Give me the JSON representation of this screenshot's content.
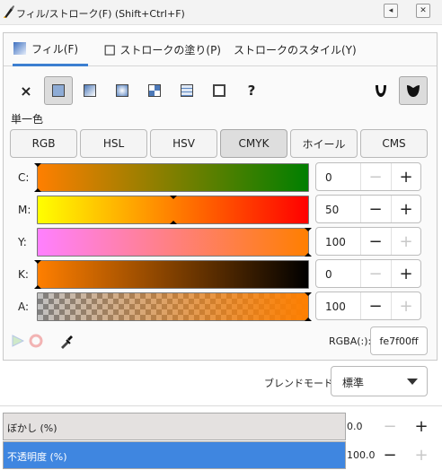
{
  "window": {
    "title": "フィル/ストローク(F) (Shift+Ctrl+F)",
    "detach_glyph": "◂",
    "close_glyph": "✕"
  },
  "tabs": [
    {
      "label": "フィル(F)",
      "icon": "fill-swatch-icon",
      "active": true
    },
    {
      "label": "ストロークの塗り(P)",
      "icon": "stroke-paint-icon",
      "active": false
    },
    {
      "label": "ストロークのスタイル(Y)",
      "icon": "stroke-style-icon",
      "active": false
    }
  ],
  "paint_types": {
    "none_glyph": "×",
    "unknown_glyph": "?",
    "items": [
      "no-paint-icon",
      "flat-color-icon",
      "linear-gradient-icon",
      "radial-gradient-icon",
      "pattern-icon",
      "swatch-grid-icon",
      "swatch-icon",
      "unset-paint-icon"
    ],
    "selected": "flat-color-icon",
    "fill_rules": [
      "fill-rule-evenodd-icon",
      "fill-rule-nonzero-icon"
    ]
  },
  "flat_color_label": "単一色",
  "color_modes": [
    {
      "label": "RGB",
      "active": false
    },
    {
      "label": "HSL",
      "active": false
    },
    {
      "label": "HSV",
      "active": false
    },
    {
      "label": "CMYK",
      "active": true
    },
    {
      "label": "ホイール",
      "active": false
    },
    {
      "label": "CMS",
      "active": false
    }
  ],
  "channels": [
    {
      "label": "C:",
      "value": "0",
      "level": 0,
      "minus_enabled": false,
      "plus_enabled": true,
      "gradient": [
        "#ff7f00",
        "#007f00"
      ]
    },
    {
      "label": "M:",
      "value": "50",
      "level": 0.5,
      "minus_enabled": true,
      "plus_enabled": true,
      "gradient": [
        "#ffff00",
        "#ff0000"
      ]
    },
    {
      "label": "Y:",
      "value": "100",
      "level": 1,
      "minus_enabled": true,
      "plus_enabled": false,
      "gradient": [
        "#ff80ff",
        "#ff7f00"
      ]
    },
    {
      "label": "K:",
      "value": "0",
      "level": 0,
      "minus_enabled": false,
      "plus_enabled": true,
      "gradient": [
        "#ff7f00",
        "#000000"
      ]
    },
    {
      "label": "A:",
      "value": "100",
      "level": 1,
      "minus_enabled": true,
      "plus_enabled": false,
      "gradient": [
        "rgba(254,127,0,0)",
        "#fe7f00"
      ]
    }
  ],
  "tools": [
    "color-managed-icon",
    "out-of-gamut-icon",
    "eyedropper-icon"
  ],
  "rgba": {
    "label": "RGBA(:):",
    "value": "fe7f00ff"
  },
  "blend": {
    "label": "ブレンドモード:",
    "value": "標準"
  },
  "blur": {
    "label": "ぼかし (%)",
    "value": "0.0",
    "level": 0
  },
  "opacity": {
    "label": "不透明度 (%)",
    "value": "100.0",
    "level": 1
  },
  "symbols": {
    "minus": "−",
    "plus": "+"
  },
  "colors": {
    "accent": "#3c7fd1",
    "fill_color": "#fe7f00",
    "opacity_bar": "#3f86e0"
  }
}
